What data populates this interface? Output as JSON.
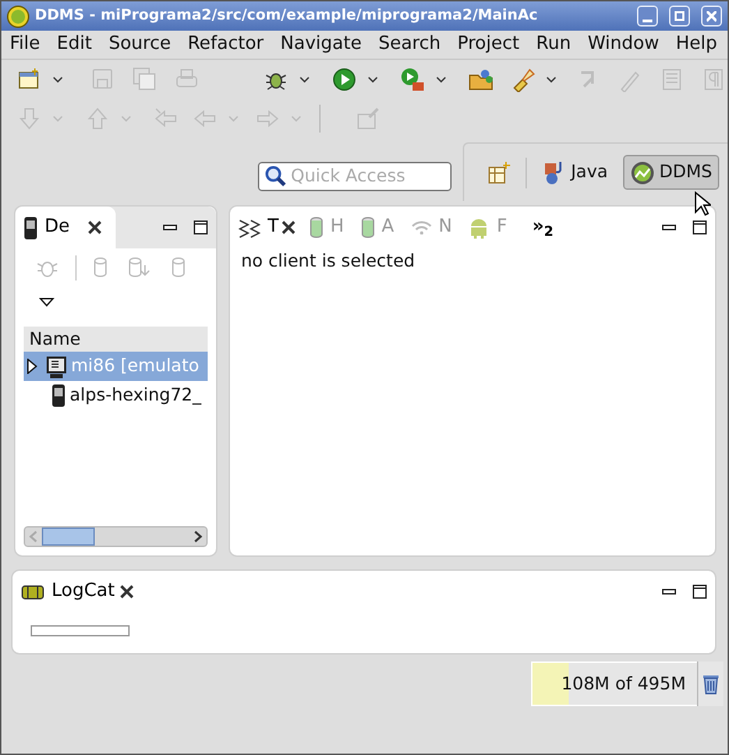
{
  "window": {
    "title": "DDMS - miPrograma2/src/com/example/miprograma2/MainAc"
  },
  "menu": [
    "File",
    "Edit",
    "Source",
    "Refactor",
    "Navigate",
    "Search",
    "Project",
    "Run",
    "Window",
    "Help"
  ],
  "toolbar": {
    "row_1": [
      {
        "disabled": false,
        "dropdown": true
      },
      {
        "disabled": true,
        "dropdown": false
      },
      {
        "disabled": true,
        "dropdown": false
      },
      {
        "disabled": true,
        "dropdown": false
      },
      {
        "disabled": false,
        "dropdown": true
      },
      {
        "disabled": false,
        "dropdown": true
      },
      {
        "disabled": false,
        "dropdown": true
      },
      {
        "disabled": false,
        "dropdown": false
      },
      {
        "disabled": false,
        "dropdown": true
      },
      {
        "disabled": true,
        "dropdown": false
      },
      {
        "disabled": true,
        "dropdown": false
      },
      {
        "disabled": true,
        "dropdown": false
      },
      {
        "disabled": true,
        "dropdown": false
      }
    ],
    "row_2": [
      {
        "disabled": true,
        "dropdown": true
      },
      {
        "disabled": true,
        "dropdown": true
      },
      {
        "disabled": true,
        "dropdown": false
      },
      {
        "disabled": true,
        "dropdown": true
      },
      {
        "disabled": true,
        "dropdown": true
      },
      {
        "disabled": true,
        "dropdown": false
      }
    ]
  },
  "quick_access": {
    "placeholder": "Quick Access"
  },
  "perspectives": [
    {
      "label": "Java",
      "selected": false
    },
    {
      "label": "DDMS",
      "selected": true
    }
  ],
  "devices_view": {
    "tab": "De",
    "column": "Name",
    "devices": [
      {
        "name": "mi86 [emulato",
        "kind": "emulator",
        "selected": true,
        "expanded": false
      },
      {
        "name": "alps-hexing72_",
        "kind": "phone",
        "selected": false
      }
    ]
  },
  "client_view": {
    "tabs": [
      {
        "label": "T",
        "kind": "threads",
        "selected": true
      },
      {
        "label": "H",
        "kind": "heap",
        "selected": false
      },
      {
        "label": "A",
        "kind": "allocation",
        "selected": false
      },
      {
        "label": "N",
        "kind": "network",
        "selected": false
      },
      {
        "label": "F",
        "kind": "files",
        "selected": false
      }
    ],
    "overflow": "»$_{2}$",
    "message": "no client is selected"
  },
  "logcat": {
    "tab": "LogCat"
  },
  "heap": {
    "reading": "108M of 495M",
    "level": 0.22
  }
}
